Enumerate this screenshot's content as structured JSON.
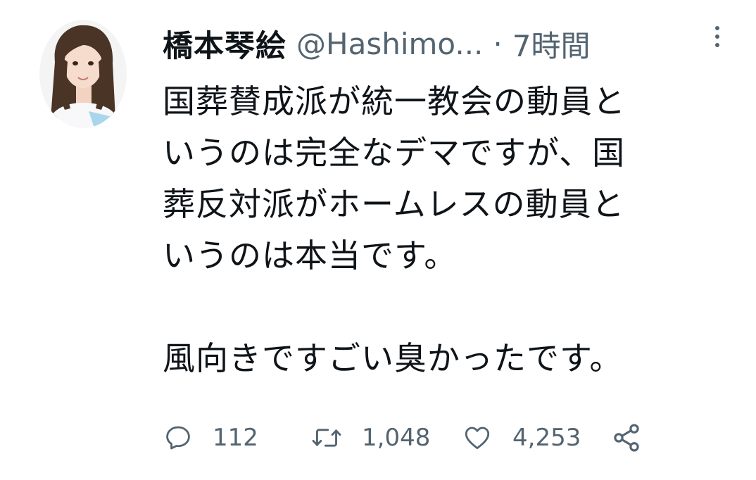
{
  "tweet": {
    "display_name": "橋本琴絵",
    "handle": "@Hashimo...",
    "separator": "·",
    "timestamp": "7時間",
    "text_lines": [
      "国葬賛成派が統一教会の動員と",
      "いうのは完全なデマですが、国",
      "葬反対派がホームレスの動員と",
      "いうのは本当です。",
      "",
      "風向きですごい臭かったです。"
    ]
  },
  "actions": {
    "reply_count": "112",
    "retweet_count": "1,048",
    "like_count": "4,253"
  },
  "icons": {
    "more": "more-vertical-icon",
    "reply": "reply-bubble-icon",
    "retweet": "retweet-arrows-icon",
    "like": "heart-icon",
    "share": "share-icon"
  },
  "colors": {
    "text_primary": "#0f1419",
    "text_secondary": "#536471",
    "background": "#ffffff"
  }
}
